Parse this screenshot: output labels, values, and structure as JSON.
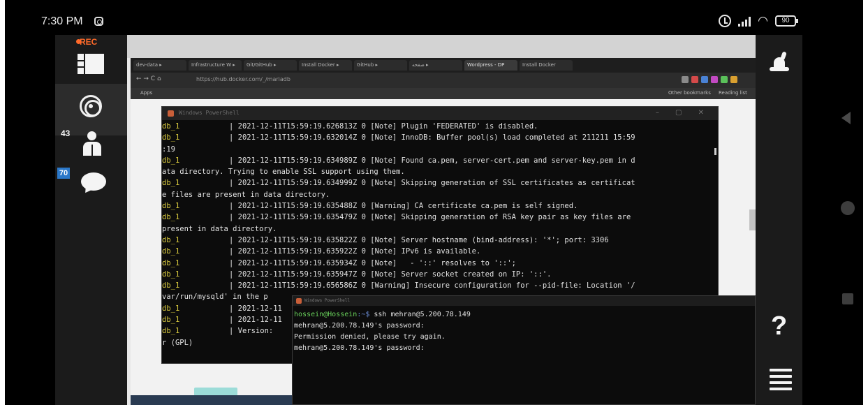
{
  "status_bar": {
    "time": "7:30 PM",
    "battery": "90"
  },
  "left_sidebar": {
    "rec_label": "REC",
    "participants_count": "43",
    "chat_unread": "70"
  },
  "browser": {
    "tabs": [
      {
        "label": "dev-data ▸"
      },
      {
        "label": "Infrastructure W ▸"
      },
      {
        "label": "Git/GitHub ▸"
      },
      {
        "label": "Install Docker ▸"
      },
      {
        "label": "GitHub ▸"
      },
      {
        "label": "صفحه ▸"
      },
      {
        "label": "Wordpress - DP"
      },
      {
        "label": "Install Docker"
      }
    ],
    "url": "https://hub.docker.com/_/mariadb",
    "bookmarks": [
      "Apps",
      "Other bookmarks",
      "Reading list"
    ]
  },
  "terminal_main": {
    "title": "Windows PowerShell",
    "lines": [
      {
        "svc": "db_1",
        "text": "| 2021-12-11T15:59:19.626813Z 0 [Note] Plugin 'FEDERATED' is disabled."
      },
      {
        "svc": "db_1",
        "text": "| 2021-12-11T15:59:19.632014Z 0 [Note] InnoDB: Buffer pool(s) load completed at 211211 15:59"
      },
      {
        "svc": "",
        "text": ":19"
      },
      {
        "svc": "db_1",
        "text": "| 2021-12-11T15:59:19.634989Z 0 [Note] Found ca.pem, server-cert.pem and server-key.pem in d"
      },
      {
        "svc": "",
        "text": "ata directory. Trying to enable SSL support using them."
      },
      {
        "svc": "db_1",
        "text": "| 2021-12-11T15:59:19.634999Z 0 [Note] Skipping generation of SSL certificates as certificat"
      },
      {
        "svc": "",
        "text": "e files are present in data directory."
      },
      {
        "svc": "db_1",
        "text": "| 2021-12-11T15:59:19.635488Z 0 [Warning] CA certificate ca.pem is self signed."
      },
      {
        "svc": "db_1",
        "text": "| 2021-12-11T15:59:19.635479Z 0 [Note] Skipping generation of RSA key pair as key files are"
      },
      {
        "svc": "",
        "text": "present in data directory."
      },
      {
        "svc": "db_1",
        "text": "| 2021-12-11T15:59:19.635822Z 0 [Note] Server hostname (bind-address): '*'; port: 3306"
      },
      {
        "svc": "db_1",
        "text": "| 2021-12-11T15:59:19.635922Z 0 [Note] IPv6 is available."
      },
      {
        "svc": "db_1",
        "text": "| 2021-12-11T15:59:19.635934Z 0 [Note]   - '::' resolves to '::';"
      },
      {
        "svc": "db_1",
        "text": "| 2021-12-11T15:59:19.635947Z 0 [Note] Server socket created on IP: '::'."
      },
      {
        "svc": "db_1",
        "text": "| 2021-12-11T15:59:19.656586Z 0 [Warning] Insecure configuration for --pid-file: Location '/"
      },
      {
        "svc": "",
        "text": "var/run/mysqld' in the p"
      },
      {
        "svc": "db_1",
        "text": "| 2021-12-11"
      },
      {
        "svc": "db_1",
        "text": "| 2021-12-11"
      },
      {
        "svc": "db_1",
        "text": "| Version:"
      },
      {
        "svc": "",
        "text": "r (GPL)"
      }
    ]
  },
  "terminal_ssh": {
    "title": "Windows PowerShell",
    "prompt_user": "hossein@Hossein",
    "prompt_path": ":~$",
    "command": " ssh mehran@5.200.78.149",
    "lines": [
      "mehran@5.200.78.149's password:",
      "Permission denied, please try again.",
      "mehran@5.200.78.149's password:"
    ]
  },
  "right_panel": {
    "help_label": "?"
  },
  "colors": {
    "rec": "#ff6a2a",
    "terminal_service": "#d8c93d",
    "prompt_user": "#6ad35c",
    "chat_badge": "#2b78c9"
  }
}
